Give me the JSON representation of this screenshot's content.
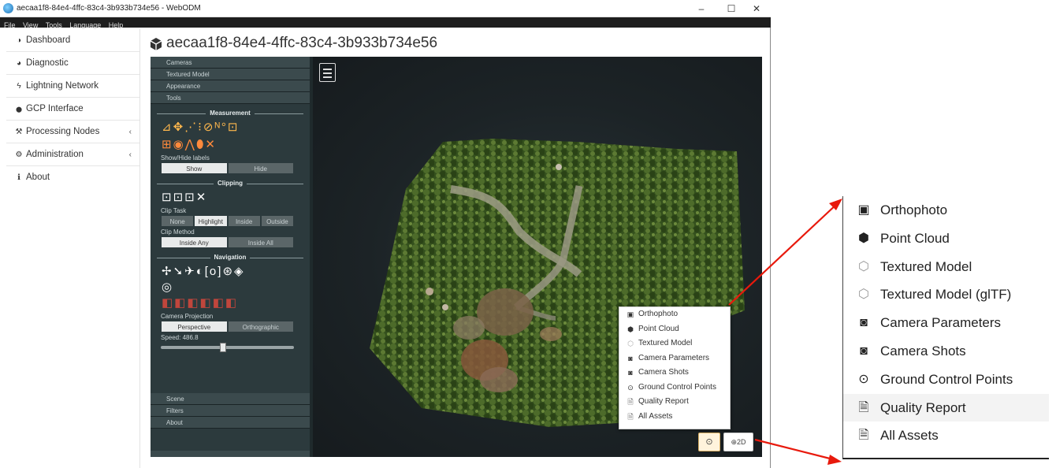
{
  "window": {
    "title": "aecaa1f8-84e4-4ffc-83c4-3b933b734e56 - WebODM",
    "controls": {
      "minimize": "–",
      "maximize": "☐",
      "close": "✕"
    }
  },
  "menubar": [
    "File",
    "View",
    "Tools",
    "Language",
    "Help"
  ],
  "sidebar": {
    "items": [
      {
        "label": "Dashboard",
        "icon": "dashboard-icon",
        "glyph": "◑"
      },
      {
        "label": "Diagnostic",
        "icon": "pie-chart-icon",
        "glyph": "◕"
      },
      {
        "label": "Lightning Network",
        "icon": "bolt-icon",
        "glyph": "ϟ"
      },
      {
        "label": "GCP Interface",
        "icon": "map-marker-icon",
        "glyph": "⬤"
      },
      {
        "label": "Processing Nodes",
        "icon": "wrench-icon",
        "glyph": "🔧",
        "chevron": "‹"
      },
      {
        "label": "Administration",
        "icon": "cogs-icon",
        "glyph": "⚙",
        "chevron": "‹"
      },
      {
        "label": "About",
        "icon": "info-icon",
        "glyph": "ℹ"
      }
    ]
  },
  "page": {
    "title": "aecaa1f8-84e4-4ffc-83c4-3b933b734e56",
    "title_icon": "cube-icon"
  },
  "potree": {
    "top_accordion": [
      "Cameras",
      "Textured Model",
      "Appearance",
      "Tools"
    ],
    "measurement": {
      "heading": "Measurement",
      "tools_row1": "⊿✥⋰⁝⊘ᴺ°⊡",
      "tools_row2": "⊞◉⋀⬮✕",
      "show_hide_label": "Show/Hide labels",
      "show_hide": [
        "Show",
        "Hide"
      ],
      "show_hide_active": 0
    },
    "clipping": {
      "heading": "Clipping",
      "tools": "⊡⊡⊡✕",
      "task_label": "Clip Task",
      "task": [
        "None",
        "Highlight",
        "Inside",
        "Outside"
      ],
      "task_active": 1,
      "method_label": "Clip Method",
      "method": [
        "Inside Any",
        "Inside All"
      ],
      "method_active": 0
    },
    "navigation": {
      "heading": "Navigation",
      "tools_row1": "✢➘✈◐[o]⊛◈",
      "tools_row2": "◎",
      "views": "◧◧◧◧◧◧",
      "projection_label": "Camera Projection",
      "projection": [
        "Perspective",
        "Orthographic"
      ],
      "projection_active": 0,
      "speed_label": "Speed: 486.8",
      "speed_fraction": 0.47
    },
    "bottom_accordion": [
      "Scene",
      "Filters",
      "About"
    ]
  },
  "assets_menu": {
    "items": [
      {
        "label": "Orthophoto",
        "icon": "image-icon",
        "glyph": "▣"
      },
      {
        "label": "Point Cloud",
        "icon": "cube-icon",
        "glyph": "⬢"
      },
      {
        "label": "Textured Model",
        "icon": "cube-outline-icon",
        "glyph": "⬡",
        "light": true
      },
      {
        "label": "Textured Model (glTF)",
        "icon": "cube-outline-icon",
        "glyph": "⬡",
        "light": true,
        "zoom_only": true
      },
      {
        "label": "Camera Parameters",
        "icon": "camera-icon",
        "glyph": "◙"
      },
      {
        "label": "Camera Shots",
        "icon": "camera-icon",
        "glyph": "◙"
      },
      {
        "label": "Ground Control Points",
        "icon": "dot-circle-icon",
        "glyph": "⊙"
      },
      {
        "label": "Quality Report",
        "icon": "pdf-file-icon",
        "glyph": "🗎"
      },
      {
        "label": "All Assets",
        "icon": "zip-file-icon",
        "glyph": "🗎"
      }
    ]
  },
  "viewer_buttons": {
    "assets": "⊙",
    "twod": "⊕2D"
  },
  "colors": {
    "panel_bg": "#2c3a3d",
    "menubar_bg": "#1e1e1e",
    "arrow": "#e8190c",
    "vegetation": "#3d5a22",
    "soil": "#8a6a4a"
  }
}
